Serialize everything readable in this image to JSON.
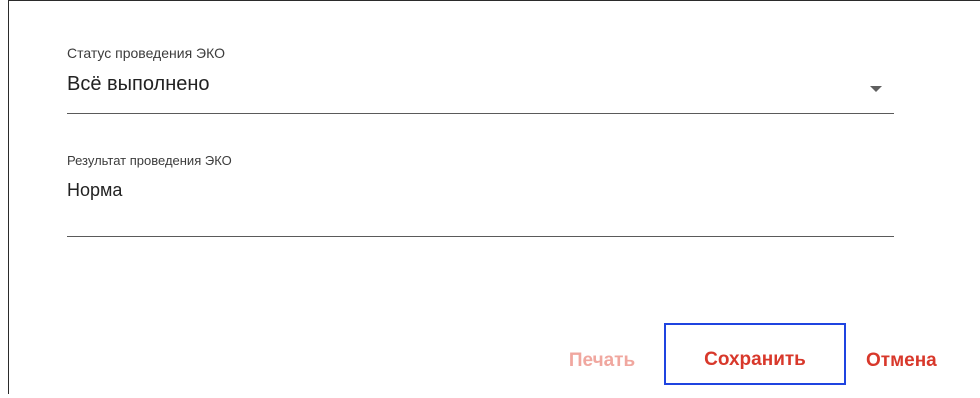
{
  "form": {
    "status": {
      "label": "Статус проведения ЭКО",
      "value": "Всё выполнено",
      "control": "dropdown",
      "icon": "chevron-down-icon"
    },
    "result": {
      "label": "Результат проведения ЭКО",
      "value": "Норма"
    }
  },
  "actions": {
    "print_label": "Печать",
    "save_label": "Сохранить",
    "cancel_label": "Отмена",
    "print_enabled": false,
    "focused": "save"
  },
  "colors": {
    "accent": "#d8382b",
    "accent_disabled": "#f0a79f",
    "focus_outline": "#1f44e0",
    "text": "#222222",
    "underline": "#5a5a5a"
  }
}
